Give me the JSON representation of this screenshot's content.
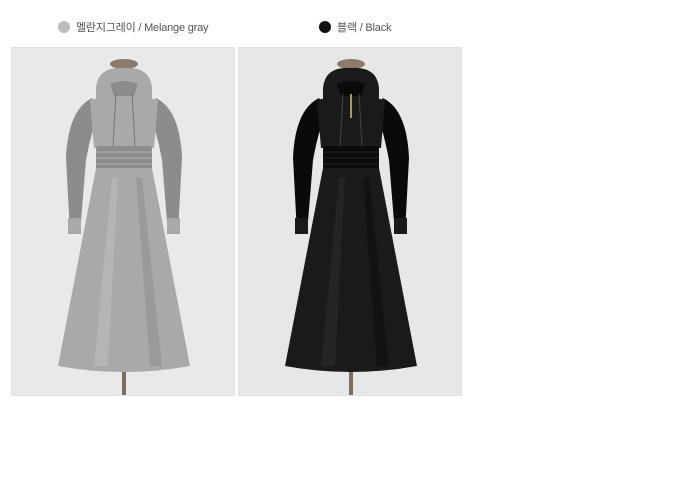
{
  "variants": [
    {
      "label": "멜란지그레이 / Melange gray",
      "swatch_color": "#bdbdbd",
      "garment_color": "#a9a9a9",
      "garment_shadow": "#8c8c8c",
      "garment_highlight": "#c2c2c2",
      "background_color": "#e9e9e9",
      "zipper": false
    },
    {
      "label": "블랙 / Black",
      "swatch_color": "#111111",
      "garment_color": "#1a1a1a",
      "garment_shadow": "#0a0a0a",
      "garment_highlight": "#2e2e2e",
      "background_color": "#e7e7e7",
      "zipper": true
    }
  ]
}
